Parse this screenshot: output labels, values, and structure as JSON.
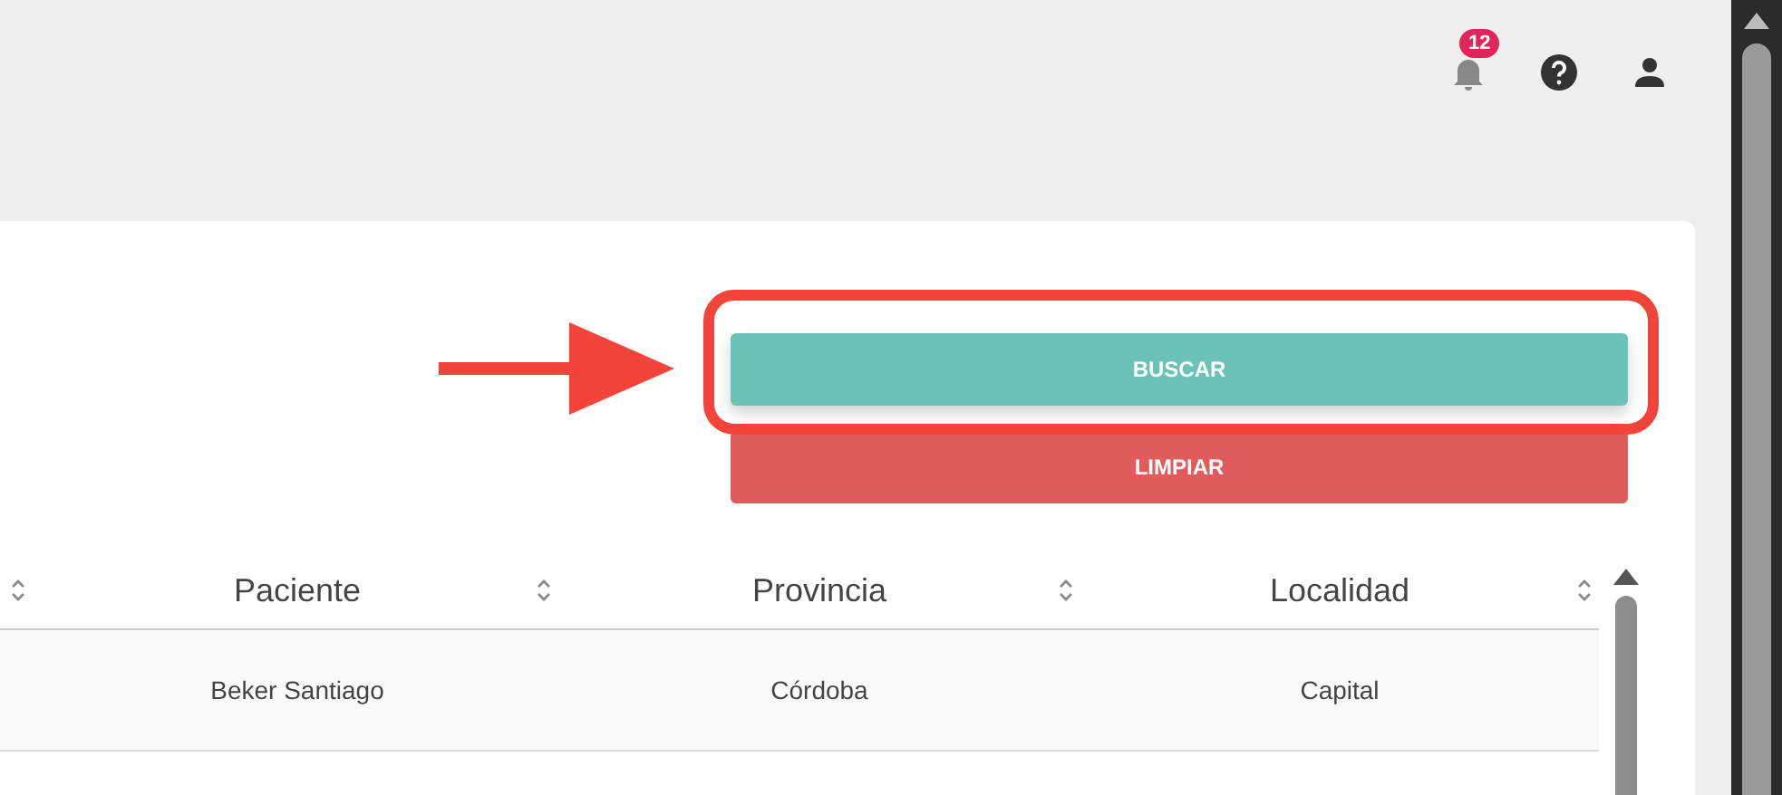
{
  "header": {
    "notifications": {
      "badge": "12"
    }
  },
  "buttons": [
    {
      "label": "BUSCAR",
      "kind": "search",
      "highlighted": true
    },
    {
      "label": "LIMPIAR",
      "kind": "clear",
      "highlighted": false
    }
  ],
  "table": {
    "columns": [
      "Paciente",
      "Provincia",
      "Localidad"
    ],
    "rows": [
      [
        "Beker Santiago",
        "Córdoba",
        "Capital"
      ]
    ]
  }
}
